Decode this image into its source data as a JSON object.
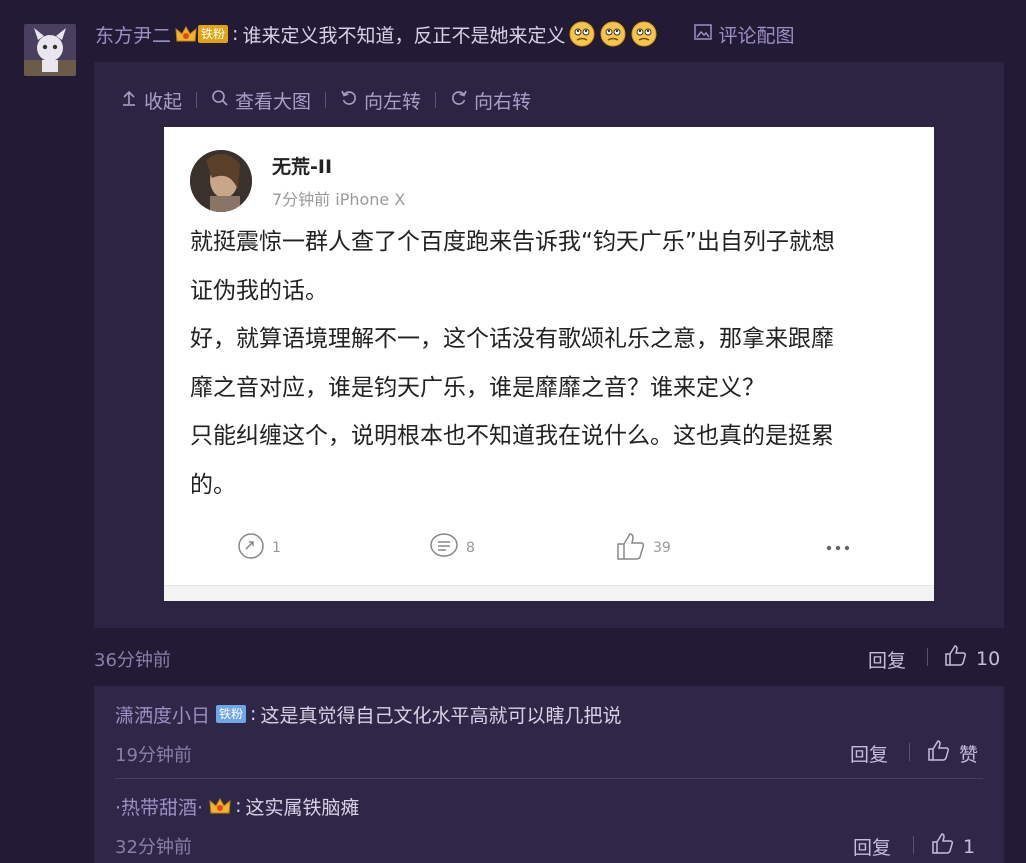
{
  "comment": {
    "author": "东方尹二",
    "badge": "铁粉",
    "text": "谁来定义我不知道，反正不是她来定义",
    "attach_label": "评论配图",
    "time": "36分钟前",
    "reply_label": "回复",
    "likes": "10"
  },
  "viewer": {
    "toolbar": [
      "收起",
      "查看大图",
      "向左转",
      "向右转"
    ]
  },
  "screenshot_post": {
    "user": "无荒-II",
    "meta": "7分钟前  iPhone X",
    "body_lines": [
      "就挺震惊一群人查了个百度跑来告诉我“钧天广乐”出自列子就想",
      "证伪我的话。",
      "好，就算语境理解不一，这个话没有歌颂礼乐之意，那拿来跟靡",
      "靡之音对应，谁是钧天广乐，谁是靡靡之音？谁来定义？",
      "只能纠缠这个，说明根本也不知道我在说什么。这也真的是挺累",
      "的。"
    ],
    "reposts": "1",
    "comments": "8",
    "likes": "39"
  },
  "sub_comments": [
    {
      "author": "潇洒度小日",
      "badge": "铁粉",
      "text": "这是真觉得自己文化水平高就可以瞎几把说",
      "time": "19分钟前",
      "reply_label": "回复",
      "like_label": "赞"
    },
    {
      "author": "·热带甜酒·",
      "text": "这实属铁脑瘫",
      "time": "32分钟前",
      "reply_label": "回复",
      "like_label": "1"
    }
  ],
  "colors": {
    "background": "#231a35",
    "panel": "#2d2342",
    "username": "#9c8fc4",
    "badge_gold": "#e2a313",
    "badge_blue": "#6fa6e8"
  }
}
